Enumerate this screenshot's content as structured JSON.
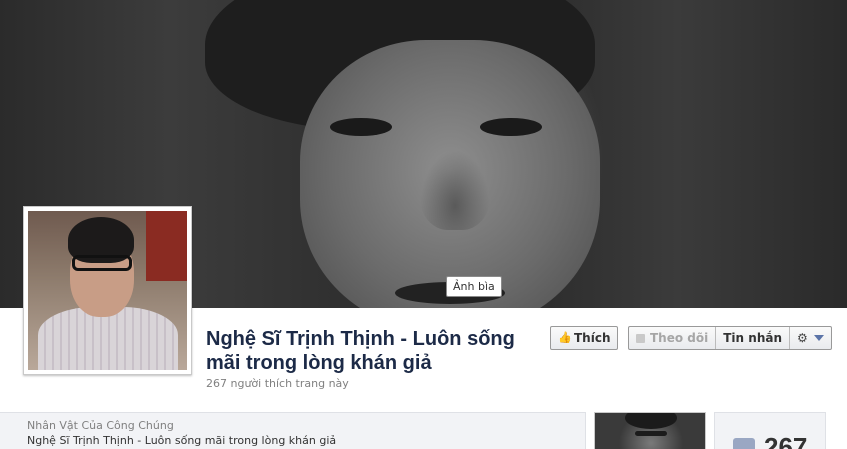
{
  "cover": {
    "photo": "cover-photo-actor-portrait",
    "label": "Ảnh bìa"
  },
  "profile": {
    "photo": "profile-photo-actor"
  },
  "page": {
    "title": "Nghệ Sĩ Trịnh Thịnh - Luôn sống mãi trong lòng khán giả",
    "likes_text": "267 người thích trang này"
  },
  "actions": {
    "like_label": "Thích",
    "like_icon": "thumbs-up-icon",
    "follow_label": "Theo dõi",
    "follow_icon": "rss-icon",
    "message_label": "Tin nhắn",
    "settings_icon": "gear-icon",
    "dropdown_icon": "caret-down-icon"
  },
  "about": {
    "category": "Nhân Vật Của Công Chúng",
    "name": "Nghệ Sĩ Trịnh Thịnh - Luôn sống mãi trong lòng khán giả"
  },
  "likes_box": {
    "count": "267",
    "icon": "thumbs-up-icon"
  },
  "colors": {
    "title": "#1c2a47",
    "caret": "#5b74a8",
    "panel_bg": "#f2f3f6"
  }
}
